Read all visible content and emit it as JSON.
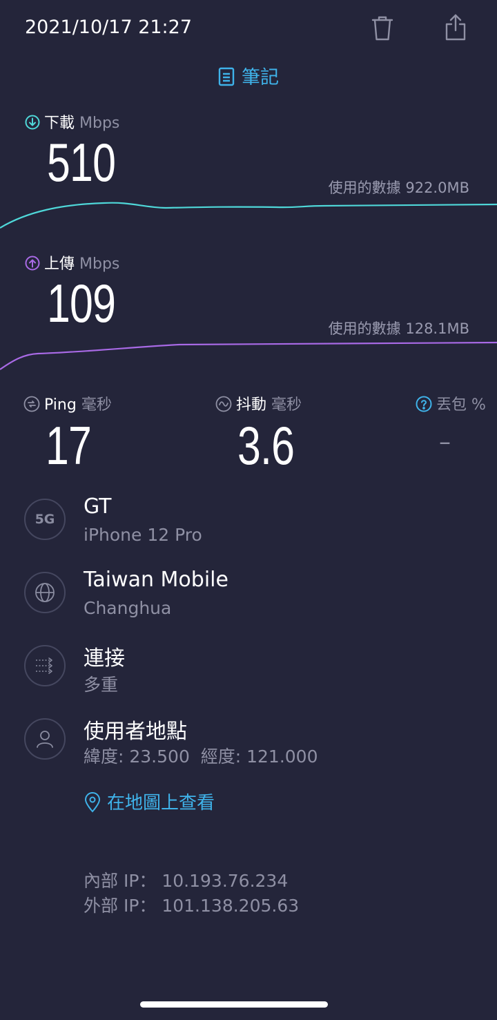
{
  "header": {
    "datetime": "2021/10/17 21:27",
    "icons": {
      "delete": "trash-icon",
      "share": "share-icon"
    }
  },
  "notes": {
    "label": "筆記",
    "icon": "notes-icon"
  },
  "download": {
    "label": "下載",
    "unit": "Mbps",
    "value": "510",
    "data_used": "使用的數據 922.0MB",
    "color": "#4fd8d9"
  },
  "upload": {
    "label": "上傳",
    "unit": "Mbps",
    "value": "109",
    "data_used": "使用的數據 128.1MB",
    "color": "#a96ae6"
  },
  "ping": {
    "label": "Ping",
    "unit": "毫秒",
    "value": "17"
  },
  "jitter": {
    "label": "抖動",
    "unit": "毫秒",
    "value": "3.6"
  },
  "packet_loss": {
    "label": "丟包",
    "unit": "%",
    "value": "–",
    "color": "#3fb3ea"
  },
  "device": {
    "badge": "5G",
    "title": "GT",
    "subtitle": "iPhone 12 Pro"
  },
  "provider": {
    "title": "Taiwan Mobile",
    "subtitle": "Changhua",
    "icon": "globe-icon"
  },
  "connection": {
    "title": "連接",
    "subtitle": "多重",
    "icon": "multi-connection-icon"
  },
  "location": {
    "title": "使用者地點",
    "subtitle": "緯度: 23.500  經度: 121.000",
    "icon": "user-icon",
    "map_link": "在地圖上查看"
  },
  "ip": {
    "internal": "內部 IP： 10.193.76.234",
    "external": "外部 IP： 101.138.205.63"
  },
  "colors": {
    "background": "#24253a",
    "accent": "#3fb3ea"
  }
}
